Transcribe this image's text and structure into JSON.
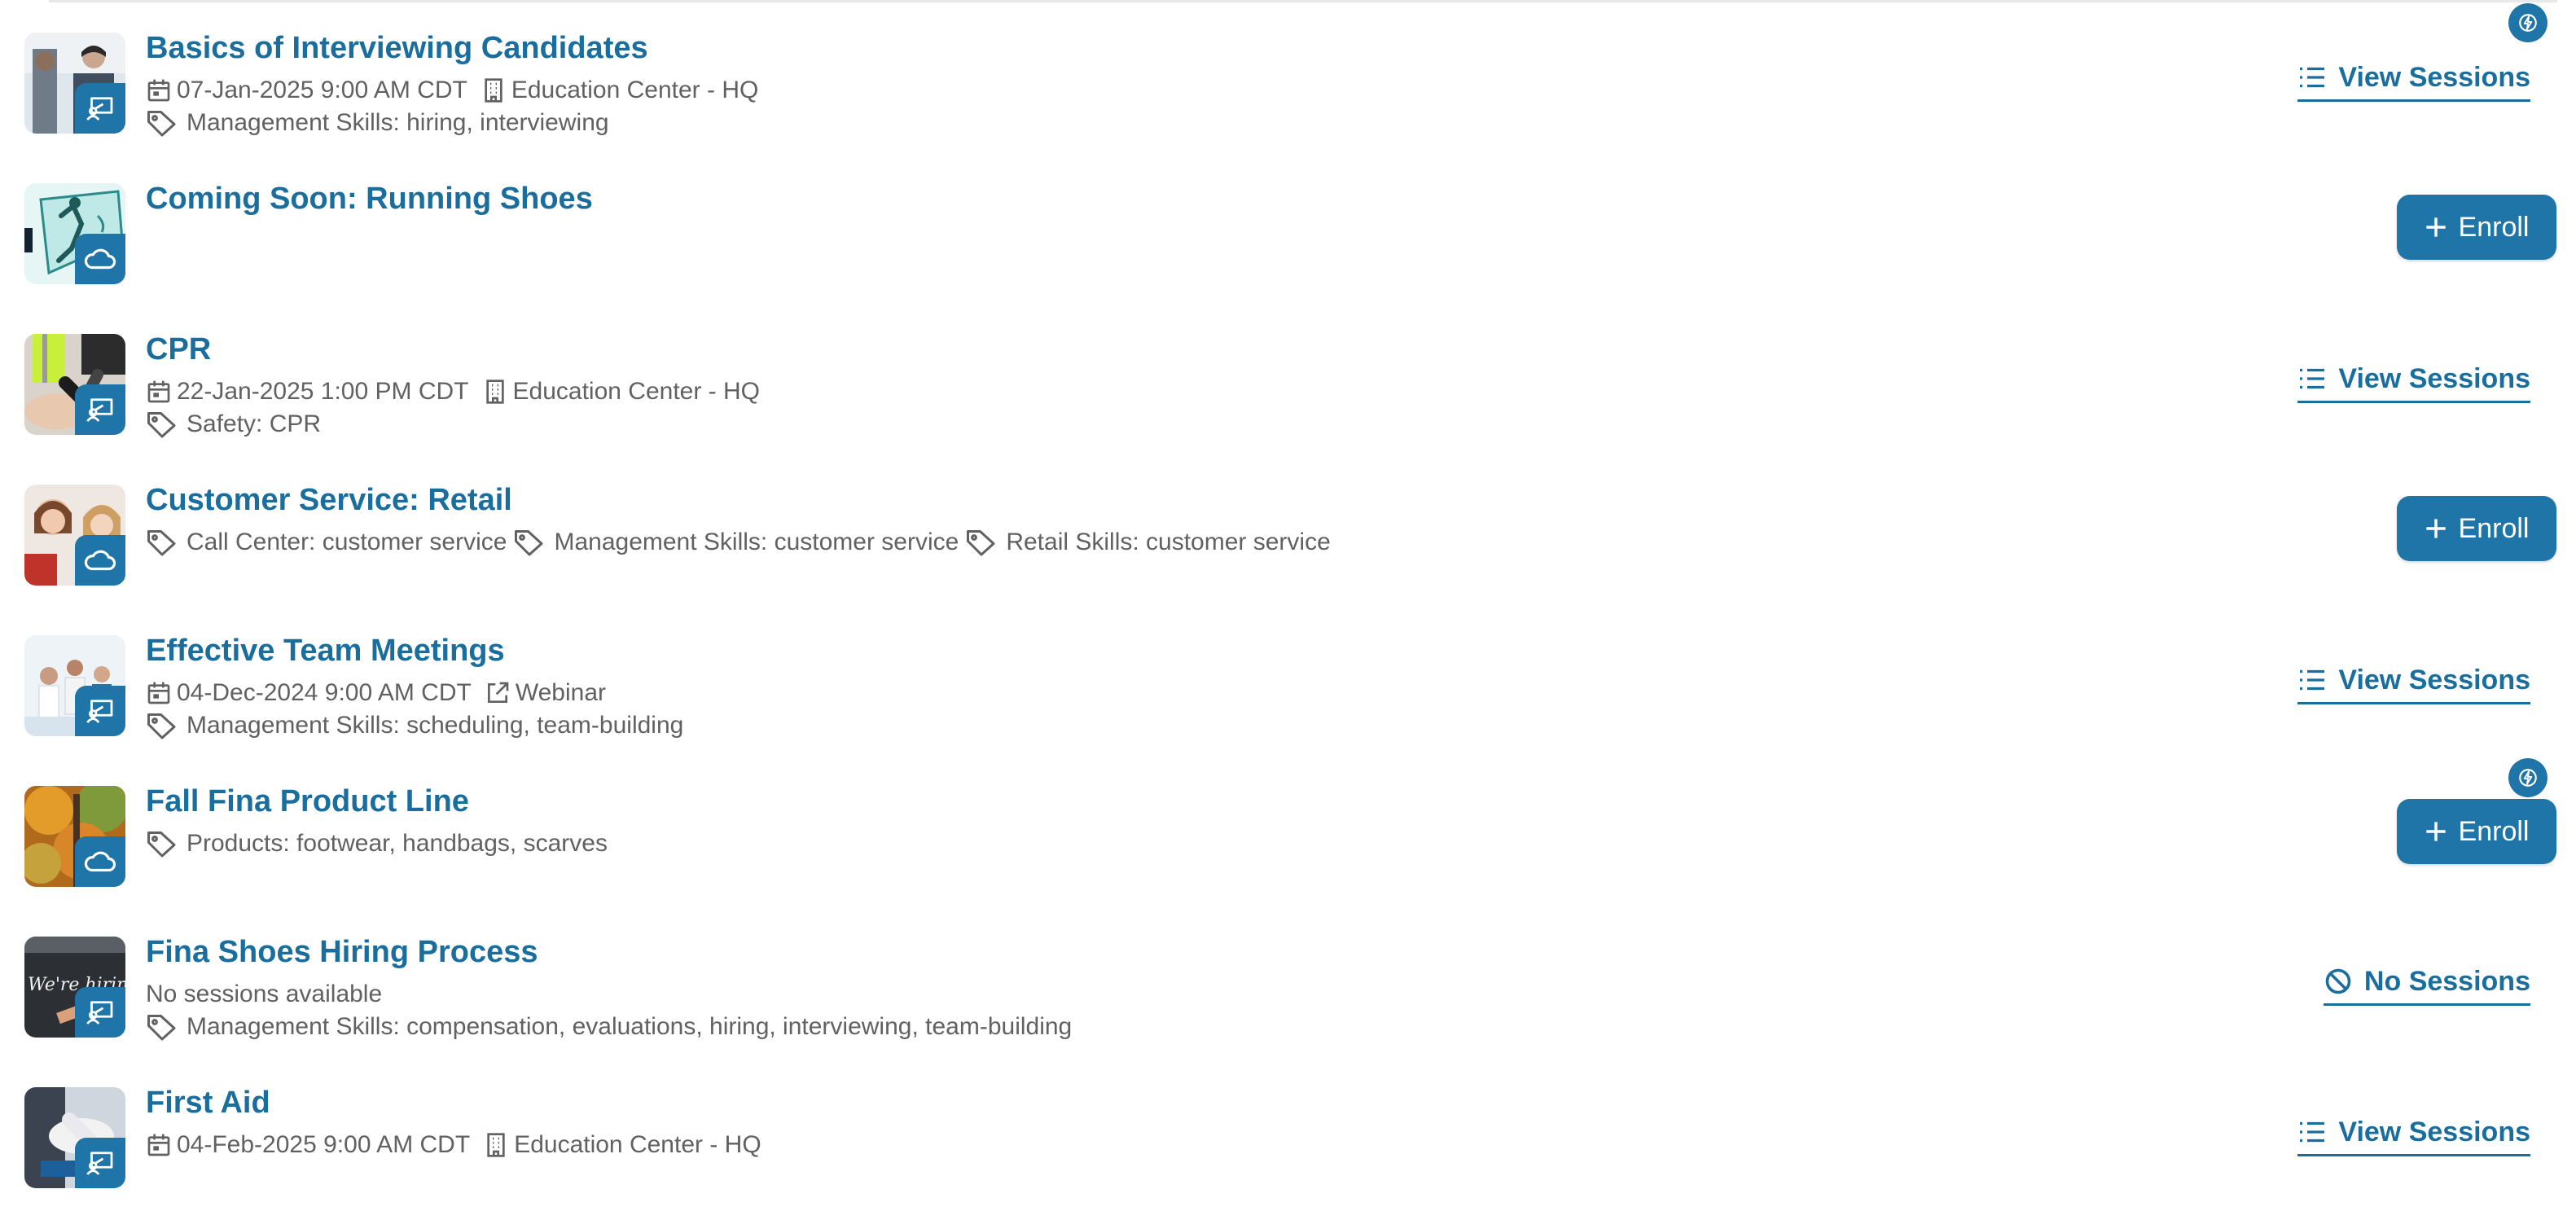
{
  "courses": [
    {
      "title": "Basics of Interviewing Candidates",
      "date": "07-Jan-2025 9:00 AM CDT",
      "location": "Education Center - HQ",
      "tags": [
        "Management Skills: hiring, interviewing"
      ],
      "action": "View Sessions",
      "badge_icon": "classroom-icon"
    },
    {
      "title": "Coming Soon: Running Shoes",
      "action": "Enroll",
      "badge_icon": "cloud-icon"
    },
    {
      "title": "CPR",
      "date": "22-Jan-2025 1:00 PM CDT",
      "location": "Education Center - HQ",
      "tags": [
        "Safety: CPR"
      ],
      "action": "View Sessions",
      "badge_icon": "classroom-icon"
    },
    {
      "title": "Customer Service: Retail",
      "tags": [
        "Call Center: customer service",
        "Management Skills: customer service",
        "Retail Skills: customer service"
      ],
      "action": "Enroll",
      "badge_icon": "cloud-icon"
    },
    {
      "title": "Effective Team Meetings",
      "date": "04-Dec-2024 9:00 AM CDT",
      "location": "Webinar",
      "tags": [
        "Management Skills: scheduling, team-building"
      ],
      "action": "View Sessions",
      "badge_icon": "classroom-icon"
    },
    {
      "title": "Fall Fina Product Line",
      "tags": [
        "Products: footwear, handbags, scarves"
      ],
      "action": "Enroll",
      "badge_icon": "cloud-icon"
    },
    {
      "title": "Fina Shoes Hiring Process",
      "status": "No sessions available",
      "tags": [
        "Management Skills: compensation, evaluations, hiring, interviewing, team-building"
      ],
      "action": "No Sessions",
      "badge_icon": "classroom-icon"
    },
    {
      "title": "First Aid",
      "date": "04-Feb-2025 9:00 AM CDT",
      "location": "Education Center - HQ",
      "action": "View Sessions",
      "badge_icon": "classroom-icon"
    }
  ],
  "colors": {
    "accent": "#1f75a8",
    "title": "#1a6e9e",
    "meta_text": "#616161"
  },
  "icons": {
    "calendar": "calendar-icon",
    "building": "building-icon",
    "external": "external-link-icon",
    "tag": "tag-icon",
    "list": "list-icon",
    "plus": "plus-icon",
    "ban": "ban-icon",
    "bolt": "lightning-icon"
  }
}
